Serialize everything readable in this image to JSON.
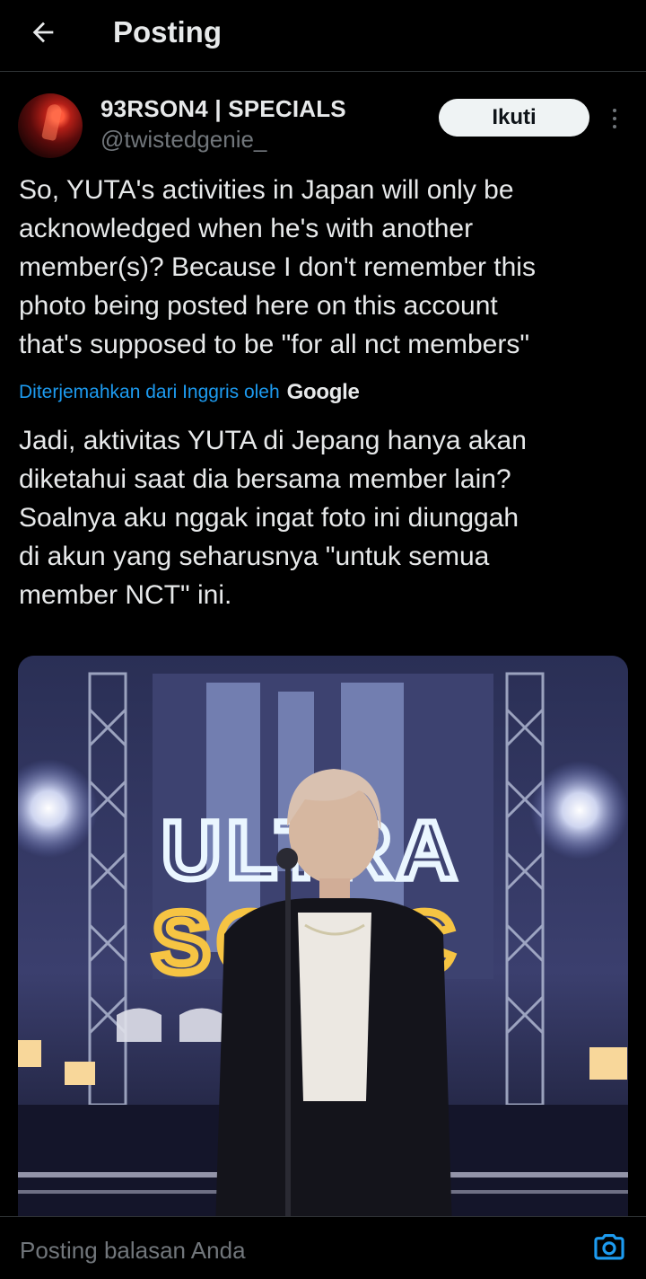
{
  "header": {
    "title": "Posting",
    "back_icon": "arrow-left-icon"
  },
  "author": {
    "display_name": "93RSON4 | SPECIALS",
    "handle": "@twistedgenie_",
    "follow_label": "Ikuti"
  },
  "post": {
    "original_text": "So, YUTA's activities in Japan will only be\nacknowledged when he's with another\nmember(s)? Because I don't remember this\nphoto being posted here on this account\nthat's supposed to be \"for all nct members\"",
    "translation_label": "Diterjemahkan dari Inggris oleh",
    "translation_brand": "Google",
    "translated_text": "Jadi, aktivitas YUTA di Jepang hanya akan\ndiketahui saat dia bersama member lain?\nSoalnya aku nggak ingat foto ini diunggah\ndi akun yang seharusnya \"untuk semua\nmember NCT\" ini.",
    "image": {
      "sign_row1": "ULTRA",
      "sign_row2": "SONIC"
    }
  },
  "reply": {
    "placeholder": "Posting balasan Anda",
    "camera_icon": "camera-icon"
  },
  "colors": {
    "background": "#000000",
    "text": "#e7e9ea",
    "muted": "#71767b",
    "link": "#1d9bf0",
    "follow_bg": "#eff3f4"
  }
}
